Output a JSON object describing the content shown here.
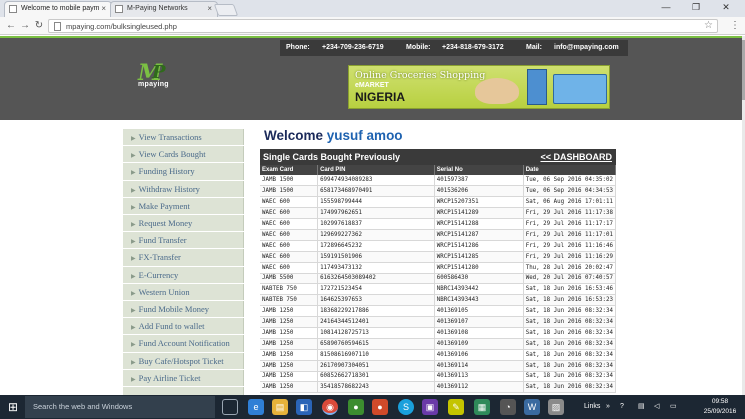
{
  "browser": {
    "tabs": [
      {
        "label": "Welcome to mobile paym",
        "active": true
      },
      {
        "label": "M-Paying Networks",
        "active": false
      }
    ],
    "url": "mpaying.com/bulksingleused.php",
    "window_controls": {
      "minimize": "—",
      "restore": "❐",
      "close": "✕"
    }
  },
  "header": {
    "phone_label": "Phone:",
    "phone_value": "+234-709-236-6719",
    "mobile_label": "Mobile:",
    "mobile_value": "+234-818-679-3172",
    "mail_label": "Mail:",
    "mail_value": "info@mpaying.com",
    "logo_text": "mpaying",
    "banner": {
      "headline": "Online Groceries Shopping",
      "small": "eMARKET",
      "country": "NIGERIA"
    },
    "accent_color": "#7bc043"
  },
  "sidebar": {
    "items": [
      {
        "label": "View Transactions"
      },
      {
        "label": "View Cards Bought"
      },
      {
        "label": "Funding History"
      },
      {
        "label": "Withdraw History"
      },
      {
        "label": "Make Payment"
      },
      {
        "label": "Request Money"
      },
      {
        "label": "Fund Transfer"
      },
      {
        "label": "FX-Transfer"
      },
      {
        "label": "E-Currency"
      },
      {
        "label": "Western Union"
      },
      {
        "label": "Fund Mobile Money"
      },
      {
        "label": "Add Fund to wallet"
      },
      {
        "label": "Fund Account Notification"
      },
      {
        "label": "Buy Cafe/Hotspot Ticket"
      },
      {
        "label": "Pay Airline Ticket"
      }
    ]
  },
  "main": {
    "welcome_prefix": "Welcome",
    "username": "yusuf amoo",
    "table_title": "Single Cards Bought Previously",
    "dashboard_link": "<< DASHBOARD",
    "columns": [
      "Exam Card",
      "Card PIN",
      "Serial No",
      "Date"
    ],
    "rows": [
      [
        "JAMB 1500",
        "699474934089283",
        "401597387",
        "Tue, 06 Sep 2016 04:35:02"
      ],
      [
        "JAMB 1500",
        "658173468970491",
        "401536206",
        "Tue, 06 Sep 2016 04:34:53"
      ],
      [
        "WAEC 600",
        "155598799444",
        "WRCP15207351",
        "Sat, 06 Aug 2016 17:01:11"
      ],
      [
        "WAEC 600",
        "174997962651",
        "WRCP15141289",
        "Fri, 29 Jul 2016 11:17:38"
      ],
      [
        "WAEC 600",
        "102997618837",
        "WRCP15141288",
        "Fri, 29 Jul 2016 11:17:17"
      ],
      [
        "WAEC 600",
        "129699227362",
        "WRCP15141287",
        "Fri, 29 Jul 2016 11:17:01"
      ],
      [
        "WAEC 600",
        "172896645232",
        "WRCP15141286",
        "Fri, 29 Jul 2016 11:16:46"
      ],
      [
        "WAEC 600",
        "159191501906",
        "WRCP15141285",
        "Fri, 29 Jul 2016 11:16:29"
      ],
      [
        "WAEC 600",
        "117493473132",
        "WRCP15141280",
        "Thu, 28 Jul 2016 20:02:47"
      ],
      [
        "JAMB 5500",
        "6163264503089402",
        "600586430",
        "Wed, 20 Jul 2016 07:40:57"
      ],
      [
        "NABTEB 750",
        "172721523454",
        "NBRC14393442",
        "Sat, 18 Jun 2016 16:53:46"
      ],
      [
        "NABTEB 750",
        "164625397653",
        "NBRC14393443",
        "Sat, 18 Jun 2016 16:53:23"
      ],
      [
        "JAMB 1250",
        "18368229217886",
        "401369105",
        "Sat, 18 Jun 2016 08:32:34"
      ],
      [
        "JAMB 1250",
        "24164344512401",
        "401369107",
        "Sat, 18 Jun 2016 08:32:34"
      ],
      [
        "JAMB 1250",
        "10814128725713",
        "401369108",
        "Sat, 18 Jun 2016 08:32:34"
      ],
      [
        "JAMB 1250",
        "65890760594615",
        "401369109",
        "Sat, 18 Jun 2016 08:32:34"
      ],
      [
        "JAMB 1250",
        "81508616907110",
        "401369106",
        "Sat, 18 Jun 2016 08:32:34"
      ],
      [
        "JAMB 1250",
        "26170907304051",
        "401369114",
        "Sat, 18 Jun 2016 08:32:34"
      ],
      [
        "JAMB 1250",
        "60852662718301",
        "401369113",
        "Sat, 18 Jun 2016 08:32:34"
      ],
      [
        "JAMB 1250",
        "35418578682243",
        "401369112",
        "Sat, 18 Jun 2016 08:32:34"
      ]
    ]
  },
  "taskbar": {
    "search_placeholder": "Search the web and Windows",
    "links_label": "Links",
    "time": "09:58",
    "date": "25/09/2016"
  }
}
